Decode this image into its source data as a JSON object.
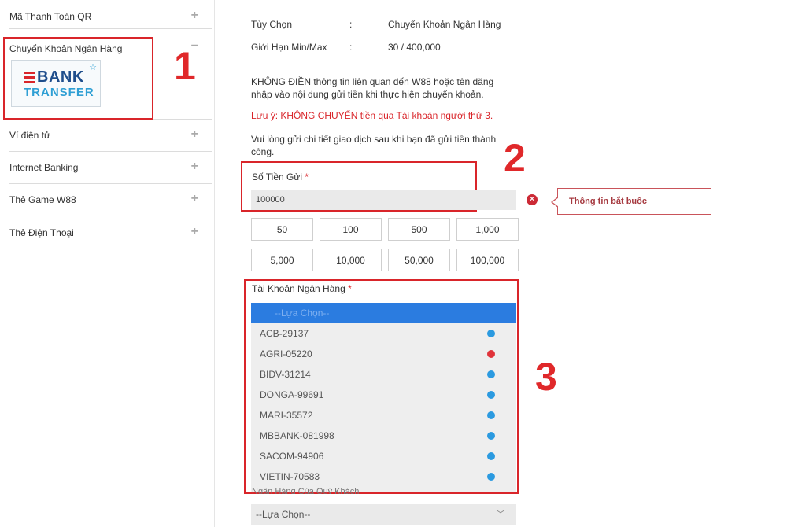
{
  "sidebar": {
    "items": [
      {
        "label": "Mã Thanh Toán QR",
        "toggle": "+"
      },
      {
        "label": "Chuyển Khoản Ngân Hàng",
        "toggle": "−"
      },
      {
        "label": "Ví điện tử",
        "toggle": "+"
      },
      {
        "label": "Internet Banking",
        "toggle": "+"
      },
      {
        "label": "Thẻ Game W88",
        "toggle": "+"
      },
      {
        "label": "Thẻ Điện Thoại",
        "toggle": "+"
      }
    ],
    "logo": {
      "line1": "BANK",
      "line2": "TRANSFER",
      "star": "☆"
    }
  },
  "annotations": {
    "n1": "1",
    "n2": "2",
    "n3": "3"
  },
  "info": {
    "option_label": "Tùy Chọn",
    "option_sep": ":",
    "option_value": "Chuyển Khoản Ngân Hàng",
    "limit_label": "Giới Hạn Min/Max",
    "limit_sep": ":",
    "limit_value": "30 / 400,000"
  },
  "notice": {
    "line1": "KHÔNG ĐIỀN thông tin liên quan đến W88 hoặc tên đăng",
    "line2": "nhập vào nội dung gửi tiền khi thực hiện chuyển khoản.",
    "warning": "Lưu ý: KHÔNG CHUYỂN tiền qua Tài khoản người thứ 3.",
    "instr1": "Vui lòng gửi chi tiết giao dịch sau khi bạn đã gửi tiền thành",
    "instr2": "công."
  },
  "amount": {
    "label": "Số Tiền Gửi",
    "required_mark": "*",
    "value": "100000",
    "error_icon": "×",
    "error_tooltip": "Thông tin bắt buộc",
    "quick": [
      "50",
      "100",
      "500",
      "1,000",
      "5,000",
      "10,000",
      "50,000",
      "100,000"
    ]
  },
  "bank_account": {
    "label": "Tài Khoản Ngân Hàng",
    "required_mark": "*",
    "placeholder": "--Lựa Chọn--",
    "options": [
      {
        "name": "ACB-29137",
        "status_color": "#2b9ae0"
      },
      {
        "name": "AGRI-05220",
        "status_color": "#e0333a"
      },
      {
        "name": "BIDV-31214",
        "status_color": "#2b9ae0"
      },
      {
        "name": "DONGA-99691",
        "status_color": "#2b9ae0"
      },
      {
        "name": "MARI-35572",
        "status_color": "#2b9ae0"
      },
      {
        "name": "MBBANK-081998",
        "status_color": "#2b9ae0"
      },
      {
        "name": "SACOM-94906",
        "status_color": "#2b9ae0"
      },
      {
        "name": "VIETIN-70583",
        "status_color": "#2b9ae0"
      }
    ]
  },
  "sender_bank": {
    "label_partial": "Ngân Hàng Của Quý Khách",
    "placeholder": "--Lựa Chọn--",
    "chevron": "﹀"
  }
}
